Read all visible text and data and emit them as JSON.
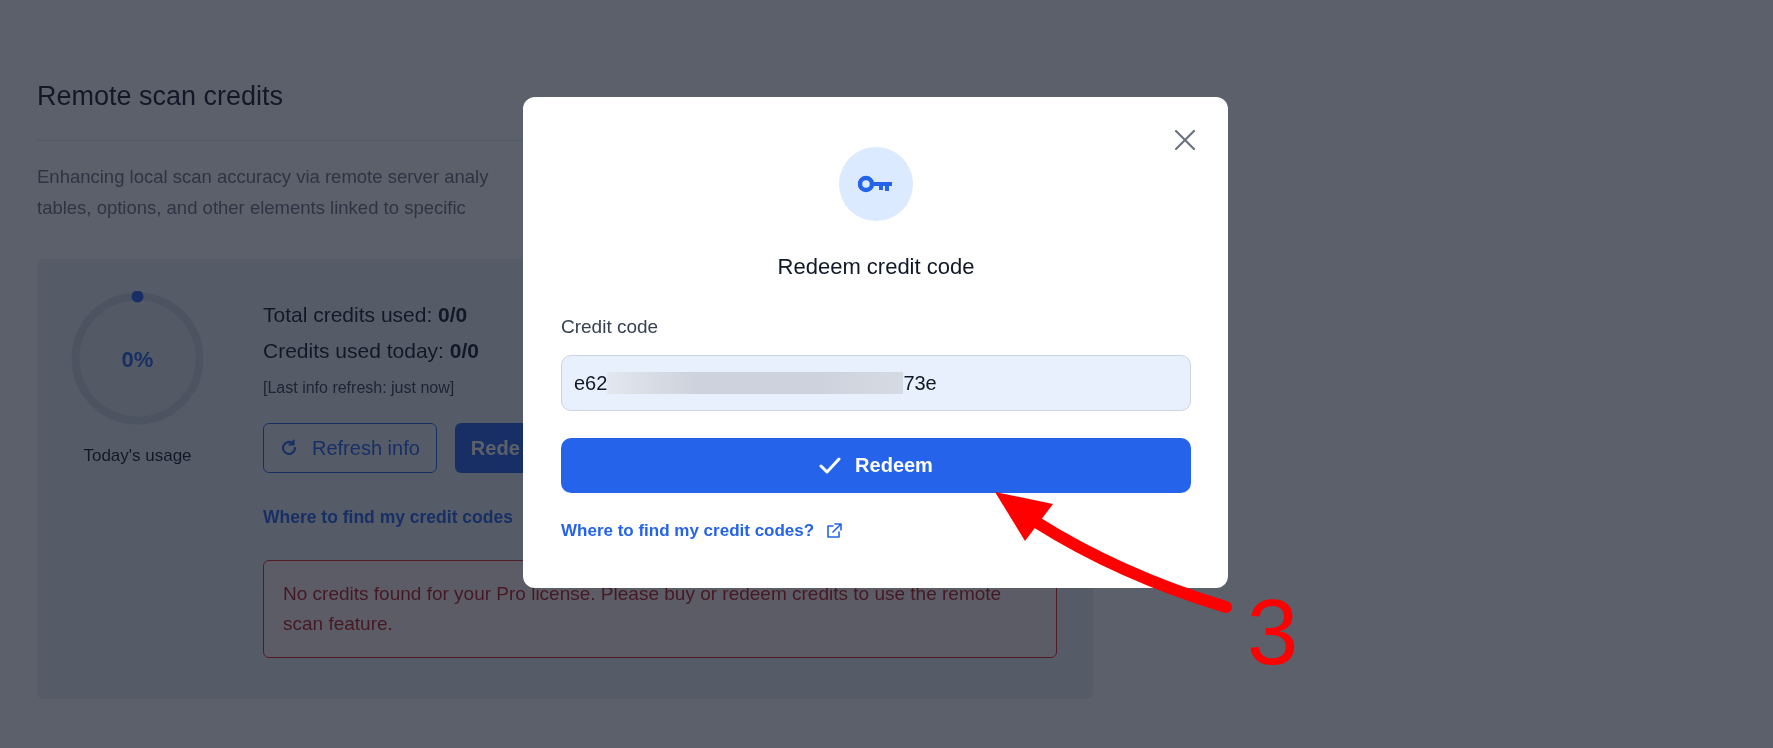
{
  "page": {
    "title": "Remote scan credits",
    "description": [
      "Enhancing local scan accuracy via remote server analy",
      "tables, options, and other elements linked to specific"
    ],
    "usage": {
      "percent": "0%",
      "caption": "Today's usage"
    },
    "stats": [
      "Total credits used: **0/0**",
      "Credits used today: **0/0**"
    ],
    "refresh_note": "[Last info refresh: just now]",
    "buttons": [
      {
        "label": "Refresh info",
        "kind": "outline"
      },
      {
        "label": "Rede",
        "kind": "primary"
      }
    ],
    "link": "Where to find my credit codes",
    "alert": "No credits found for your Pro license. Please buy or redeem credits to use the remote scan feature."
  },
  "dialog": {
    "title": "Redeem credit code",
    "field": {
      "label": "Credit code",
      "value_start": "e62",
      "value_end": "73e",
      "redacted": true
    },
    "button": "Redeem",
    "link": "Where to find my credit codes?"
  },
  "annotation": {
    "label": "3"
  }
}
